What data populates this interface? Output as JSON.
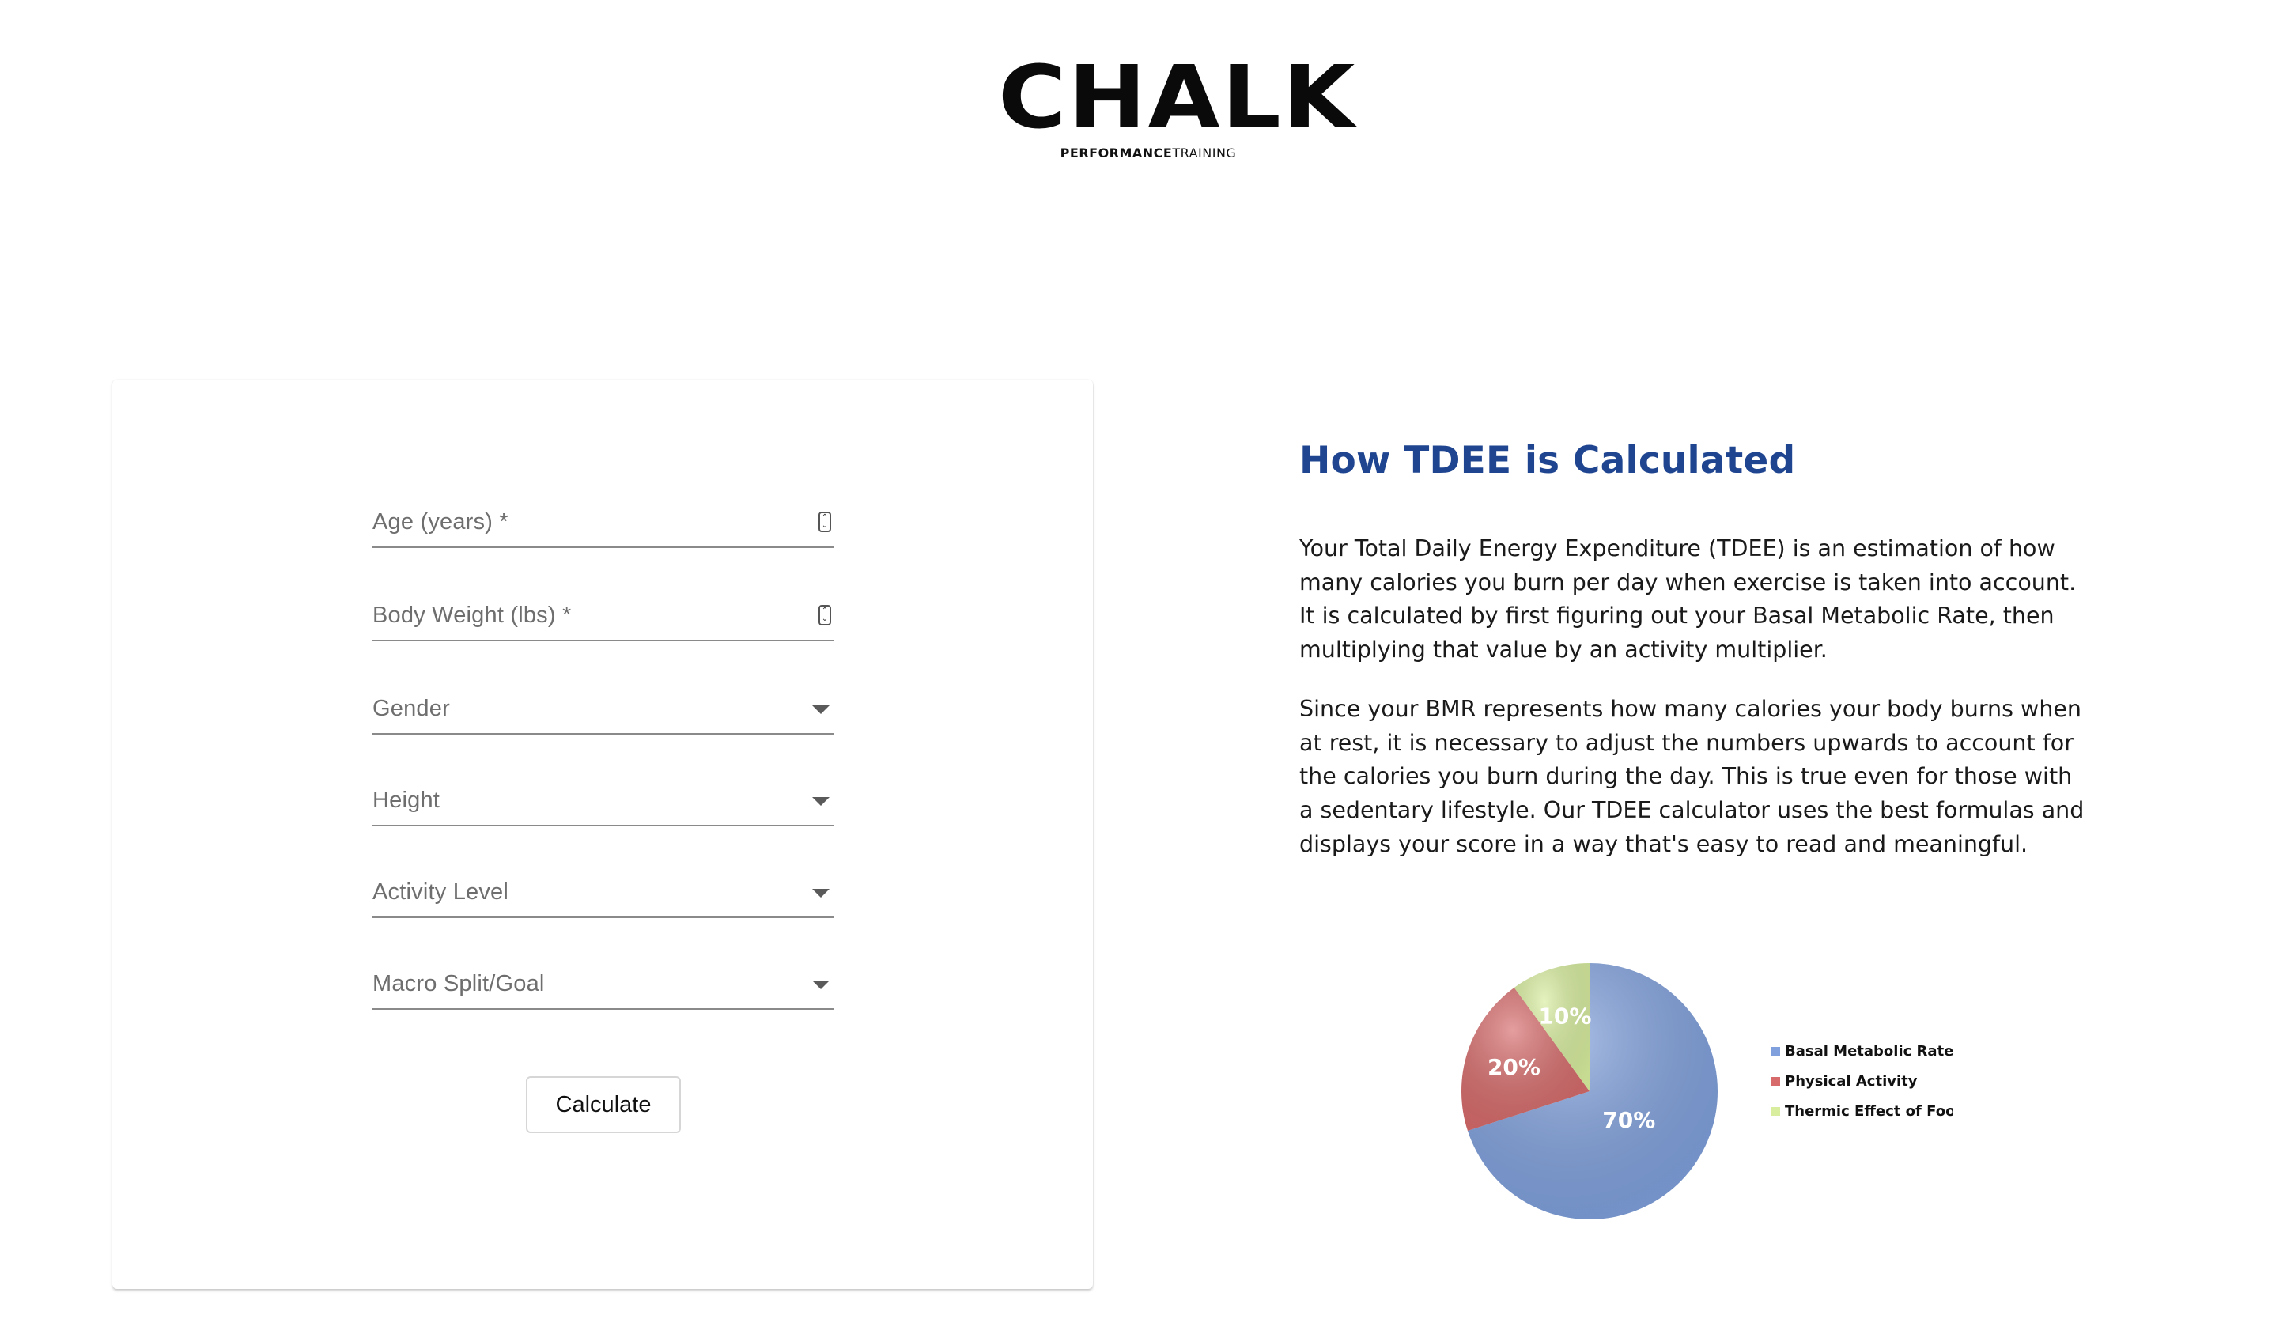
{
  "logo": {
    "wordmark": "CHALK",
    "sub_bold": "PERFORMANCE",
    "sub_regular": "TRAINING"
  },
  "form": {
    "fields": [
      {
        "label": "Age (years) *",
        "type": "number"
      },
      {
        "label": "Body Weight (lbs) *",
        "type": "number"
      },
      {
        "label": "Gender",
        "type": "select"
      },
      {
        "label": "Height",
        "type": "select"
      },
      {
        "label": "Activity Level",
        "type": "select"
      },
      {
        "label": "Macro Split/Goal",
        "type": "select"
      }
    ],
    "submit_label": "Calculate"
  },
  "info": {
    "title": "How TDEE is Calculated",
    "paragraphs": [
      "Your Total Daily Energy Expenditure (TDEE) is an estimation of how many calories you burn per day when exercise is taken into account. It is calculated by first figuring out your Basal Metabolic Rate, then multiplying that value by an activity multiplier.",
      "Since your BMR represents how many calories your body burns when at rest, it is necessary to adjust the numbers upwards to account for the calories you burn during the day. This is true even for those with a sedentary lifestyle. Our TDEE calculator uses the best formulas and displays your score in a way that's easy to read and meaningful."
    ]
  },
  "colors": {
    "title": "#1f4590",
    "pie_bmr": "#7fa0dd",
    "pie_activity": "#d76a6a",
    "pie_tef": "#d8ee9e"
  },
  "chart_data": {
    "type": "pie",
    "slices": [
      {
        "label": "Basal Metabolic Rate",
        "value": 70,
        "display": "70%",
        "color": "#7fa0dd"
      },
      {
        "label": "Physical Activity",
        "value": 20,
        "display": "20%",
        "color": "#d76a6a"
      },
      {
        "label": "Thermic Effect of Food",
        "value": 10,
        "display": "10%",
        "color": "#d8ee9e"
      }
    ],
    "legend_position": "right"
  }
}
